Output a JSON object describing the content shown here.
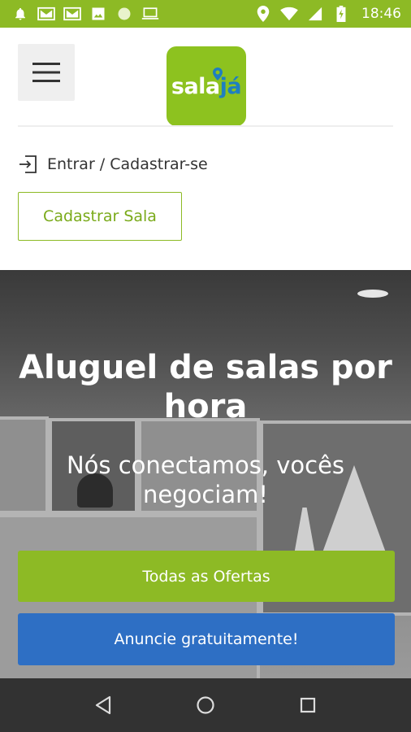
{
  "status_bar": {
    "time": "18:46",
    "left_icons": [
      "notification-bell-icon",
      "gmail-icon",
      "gmail-icon",
      "image-icon",
      "circle-icon",
      "laptop-icon"
    ],
    "right_icons": [
      "location-icon",
      "wifi-icon",
      "signal-icon",
      "battery-charging-icon"
    ]
  },
  "header": {
    "logo": {
      "text_part1": "sala",
      "text_part2": "já"
    },
    "login_link": "Entrar / Cadastrar-se",
    "register_button": "Cadastrar Sala"
  },
  "hero": {
    "title": "Aluguel de salas por hora",
    "subtitle": "Nós conectamos, vocês negociam!",
    "primary_button": "Todas as Ofertas",
    "secondary_button": "Anuncie gratuitamente!"
  },
  "colors": {
    "brand_green": "#8dba25",
    "brand_blue": "#2e6fc4"
  }
}
